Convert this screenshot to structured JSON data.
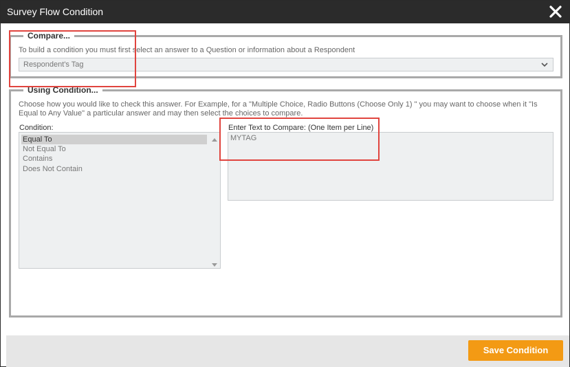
{
  "dialog": {
    "title": "Survey Flow Condition",
    "close_icon": "close-icon"
  },
  "compare": {
    "legend": "Compare...",
    "hint": "To build a condition you must first select an answer to a Question or information about a Respondent",
    "selected": "Respondent's Tag"
  },
  "using": {
    "legend": "Using Condition...",
    "hint_line1": "Choose how you would like to check this answer. For Example, for a \"Multiple Choice, Radio Buttons (Choose Only 1) \" you may want to choose when it \"Is",
    "hint_line2": "Equal to Any Value\" a particular answer and may then select the choices to compare.",
    "condition_label": "Condition:",
    "conditions": [
      "Equal To",
      "Not Equal To",
      "Contains",
      "Does Not Contain"
    ],
    "selected_condition": "Equal To",
    "compare_label": "Enter Text to Compare: (One Item per Line)",
    "compare_value": "MYTAG"
  },
  "footer": {
    "save_label": "Save Condition"
  },
  "colors": {
    "titlebar": "#2b2b2b",
    "accent": "#f39a14",
    "highlight": "#e0443e"
  }
}
